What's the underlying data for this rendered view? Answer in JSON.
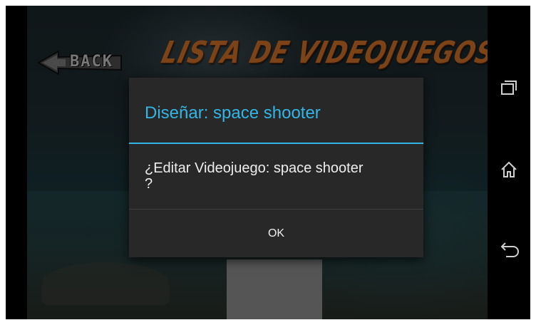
{
  "app": {
    "back_label": "BACK",
    "title": "LISTA DE VIDEOJUEGOS"
  },
  "dialog": {
    "title": "Diseñar:  space shooter",
    "message_line1": "¿Editar Videojuego: space shooter",
    "message_line2": "?",
    "ok_label": "OK"
  },
  "navigation": {
    "buttons": [
      {
        "icon": "recent-apps-icon"
      },
      {
        "icon": "home-icon"
      },
      {
        "icon": "back-arrow-icon"
      }
    ]
  },
  "colors": {
    "accent": "#33b5e5",
    "title_orange": "#e07a2a",
    "dialog_bg": "#282828",
    "grey_block": "#9b9b9b"
  }
}
